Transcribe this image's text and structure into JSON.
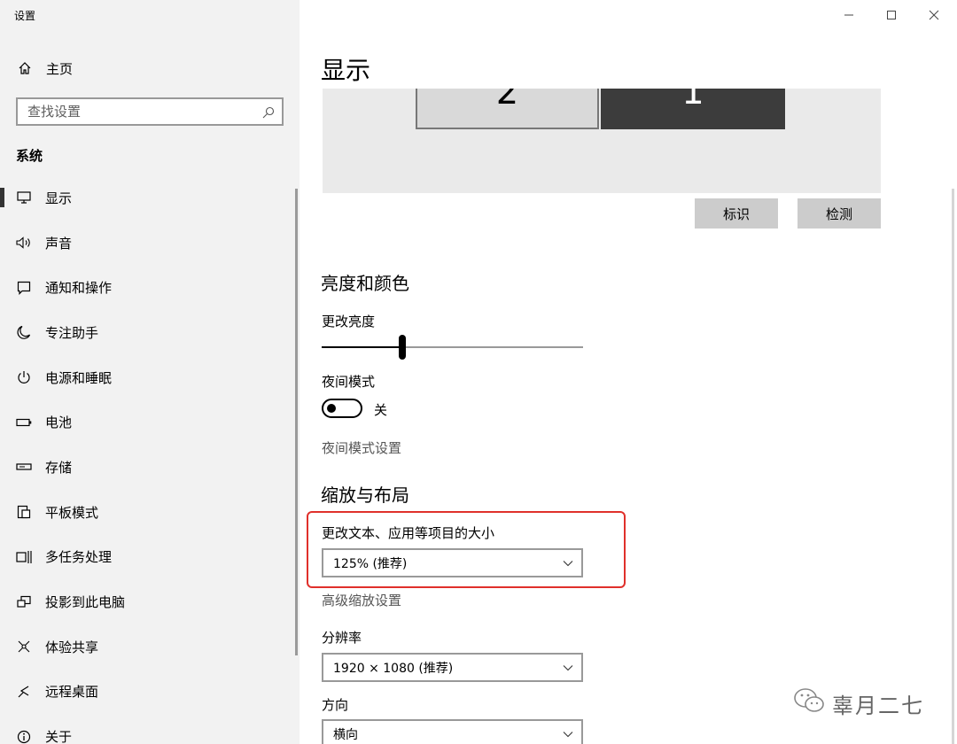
{
  "app": {
    "title": "设置"
  },
  "sidebar": {
    "home_label": "主页",
    "search_placeholder": "查找设置",
    "section_title": "系统",
    "items": [
      {
        "label": "显示",
        "icon": "monitor-icon",
        "active": true
      },
      {
        "label": "声音",
        "icon": "speaker-icon"
      },
      {
        "label": "通知和操作",
        "icon": "notification-icon"
      },
      {
        "label": "专注助手",
        "icon": "moon-icon"
      },
      {
        "label": "电源和睡眠",
        "icon": "power-icon"
      },
      {
        "label": "电池",
        "icon": "battery-icon"
      },
      {
        "label": "存储",
        "icon": "storage-icon"
      },
      {
        "label": "平板模式",
        "icon": "tablet-mode-icon"
      },
      {
        "label": "多任务处理",
        "icon": "multitask-icon"
      },
      {
        "label": "投影到此电脑",
        "icon": "project-icon"
      },
      {
        "label": "体验共享",
        "icon": "share-icon"
      },
      {
        "label": "远程桌面",
        "icon": "remote-desktop-icon"
      },
      {
        "label": "关于",
        "icon": "info-icon"
      }
    ]
  },
  "main": {
    "title": "显示",
    "monitors": {
      "left": "2",
      "right": "1"
    },
    "identify_label": "标识",
    "detect_label": "检测",
    "brightness": {
      "heading": "亮度和颜色",
      "label": "更改亮度",
      "level_percent": 31
    },
    "night_light": {
      "label": "夜间模式",
      "state": "关",
      "settings_link": "夜间模式设置"
    },
    "scale_layout": {
      "heading": "缩放与布局",
      "scale_label": "更改文本、应用等项目的大小",
      "scale_value": "125% (推荐)",
      "advanced_link": "高级缩放设置",
      "resolution_label": "分辨率",
      "resolution_value": "1920 × 1080 (推荐)",
      "orientation_label": "方向",
      "orientation_value": "横向"
    }
  },
  "watermark": {
    "text": "辜月二七"
  },
  "colors": {
    "highlight": "#e0302b",
    "sidebar_bg": "#f2f2f2",
    "button_bg": "#cccccc"
  }
}
